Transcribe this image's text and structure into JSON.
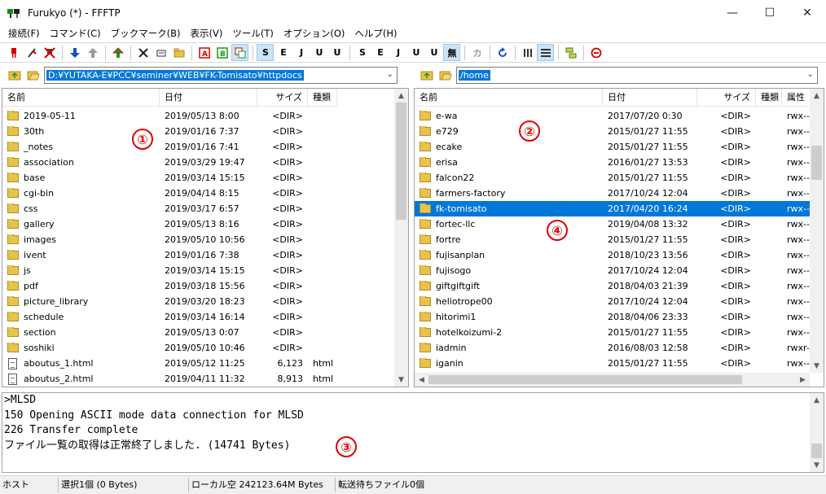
{
  "window": {
    "title": "Furukyo (*) - FFFTP",
    "minimize": "—",
    "maximize": "☐",
    "close": "✕"
  },
  "menu": [
    "接続(F)",
    "コマンド(C)",
    "ブックマーク(B)",
    "表示(V)",
    "ツール(T)",
    "オプション(O)",
    "ヘルプ(H)"
  ],
  "toolbar": {
    "text_buttons": [
      "S",
      "E",
      "J",
      "U",
      "U",
      "S",
      "E",
      "J",
      "U",
      "U",
      "無",
      "カ"
    ],
    "colors": {
      "red": "#d00000",
      "blue": "#1550c8",
      "green": "#1a9a1a",
      "gray": "#9a9a9a"
    }
  },
  "local": {
    "path": "D:¥YUTAKA-E¥PCC¥seminer¥WEB¥FK-Tomisato¥httpdocs",
    "columns": [
      "名前",
      "日付",
      "サイズ",
      "種類"
    ],
    "rows": [
      {
        "name": "2019-05-11",
        "date": "2019/05/13  8:00",
        "size": "<DIR>",
        "type": "",
        "kind": "dir"
      },
      {
        "name": "30th",
        "date": "2019/01/16  7:37",
        "size": "<DIR>",
        "type": "",
        "kind": "dir"
      },
      {
        "name": "_notes",
        "date": "2019/01/16  7:41",
        "size": "<DIR>",
        "type": "",
        "kind": "dir"
      },
      {
        "name": "association",
        "date": "2019/03/29 19:47",
        "size": "<DIR>",
        "type": "",
        "kind": "dir"
      },
      {
        "name": "base",
        "date": "2019/03/14 15:15",
        "size": "<DIR>",
        "type": "",
        "kind": "dir"
      },
      {
        "name": "cgi-bin",
        "date": "2019/04/14  8:15",
        "size": "<DIR>",
        "type": "",
        "kind": "dir"
      },
      {
        "name": "css",
        "date": "2019/03/17  6:57",
        "size": "<DIR>",
        "type": "",
        "kind": "dir"
      },
      {
        "name": "gallery",
        "date": "2019/05/13  8:16",
        "size": "<DIR>",
        "type": "",
        "kind": "dir"
      },
      {
        "name": "images",
        "date": "2019/05/10 10:56",
        "size": "<DIR>",
        "type": "",
        "kind": "dir"
      },
      {
        "name": "ivent",
        "date": "2019/01/16  7:38",
        "size": "<DIR>",
        "type": "",
        "kind": "dir"
      },
      {
        "name": "js",
        "date": "2019/03/14 15:15",
        "size": "<DIR>",
        "type": "",
        "kind": "dir"
      },
      {
        "name": "pdf",
        "date": "2019/03/18 15:56",
        "size": "<DIR>",
        "type": "",
        "kind": "dir"
      },
      {
        "name": "picture_library",
        "date": "2019/03/20 18:23",
        "size": "<DIR>",
        "type": "",
        "kind": "dir"
      },
      {
        "name": "schedule",
        "date": "2019/03/14 16:14",
        "size": "<DIR>",
        "type": "",
        "kind": "dir"
      },
      {
        "name": "section",
        "date": "2019/05/13  0:07",
        "size": "<DIR>",
        "type": "",
        "kind": "dir"
      },
      {
        "name": "soshiki",
        "date": "2019/05/10 10:46",
        "size": "<DIR>",
        "type": "",
        "kind": "dir"
      },
      {
        "name": "aboutus_1.html",
        "date": "2019/05/12 11:25",
        "size": "6,123",
        "type": "html",
        "kind": "file"
      },
      {
        "name": "aboutus_2.html",
        "date": "2019/04/11 11:32",
        "size": "8,913",
        "type": "html",
        "kind": "file"
      }
    ]
  },
  "remote": {
    "path": "/home",
    "columns": [
      "名前",
      "日付",
      "サイズ",
      "種類",
      "属性"
    ],
    "rows": [
      {
        "name": "e-wa",
        "date": "2017/07/20  0:30",
        "size": "<DIR>",
        "type": "",
        "attr": "rwx---",
        "selected": false
      },
      {
        "name": "e729",
        "date": "2015/01/27 11:55",
        "size": "<DIR>",
        "type": "",
        "attr": "rwx---",
        "selected": false
      },
      {
        "name": "ecake",
        "date": "2015/01/27 11:55",
        "size": "<DIR>",
        "type": "",
        "attr": "rwx---",
        "selected": false
      },
      {
        "name": "erisa",
        "date": "2016/01/27 13:53",
        "size": "<DIR>",
        "type": "",
        "attr": "rwx---",
        "selected": false
      },
      {
        "name": "falcon22",
        "date": "2015/01/27 11:55",
        "size": "<DIR>",
        "type": "",
        "attr": "rwx---",
        "selected": false
      },
      {
        "name": "farmers-factory",
        "date": "2017/10/24 12:04",
        "size": "<DIR>",
        "type": "",
        "attr": "rwx---",
        "selected": false
      },
      {
        "name": "fk-tomisato",
        "date": "2017/04/20 16:24",
        "size": "<DIR>",
        "type": "",
        "attr": "rwx---",
        "selected": true
      },
      {
        "name": "fortec-llc",
        "date": "2019/04/08 13:32",
        "size": "<DIR>",
        "type": "",
        "attr": "rwx---",
        "selected": false
      },
      {
        "name": "fortre",
        "date": "2015/01/27 11:55",
        "size": "<DIR>",
        "type": "",
        "attr": "rwx---",
        "selected": false
      },
      {
        "name": "fujisanplan",
        "date": "2018/10/23 13:56",
        "size": "<DIR>",
        "type": "",
        "attr": "rwx---",
        "selected": false
      },
      {
        "name": "fujisogo",
        "date": "2017/10/24 12:04",
        "size": "<DIR>",
        "type": "",
        "attr": "rwx---",
        "selected": false
      },
      {
        "name": "giftgiftgift",
        "date": "2018/04/03 21:39",
        "size": "<DIR>",
        "type": "",
        "attr": "rwx---",
        "selected": false
      },
      {
        "name": "heliotrope00",
        "date": "2017/10/24 12:04",
        "size": "<DIR>",
        "type": "",
        "attr": "rwx---",
        "selected": false
      },
      {
        "name": "hitorimi1",
        "date": "2018/04/06 23:33",
        "size": "<DIR>",
        "type": "",
        "attr": "rwx---",
        "selected": false
      },
      {
        "name": "hotelkoizumi-2",
        "date": "2015/01/27 11:55",
        "size": "<DIR>",
        "type": "",
        "attr": "rwx---",
        "selected": false
      },
      {
        "name": "iadmin",
        "date": "2016/08/03 12:58",
        "size": "<DIR>",
        "type": "",
        "attr": "rwxr-x",
        "selected": false
      },
      {
        "name": "iganin",
        "date": "2015/01/27 11:55",
        "size": "<DIR>",
        "type": "",
        "attr": "rwx---",
        "selected": false
      }
    ]
  },
  "log": [
    ">MLSD",
    "150 Opening ASCII mode data connection for MLSD",
    "226 Transfer complete",
    "ファイル一覧の取得は正常終了しました. (14741 Bytes)"
  ],
  "status": {
    "host": "ホスト",
    "selection": "選択1個 (0 Bytes)",
    "local_free": "ローカル空 242123.64M Bytes",
    "queue": "転送待ちファイル0個"
  },
  "markers": [
    "①",
    "②",
    "③",
    "④"
  ],
  "marker_color": "#e00000",
  "selection_color": "#0078d7"
}
